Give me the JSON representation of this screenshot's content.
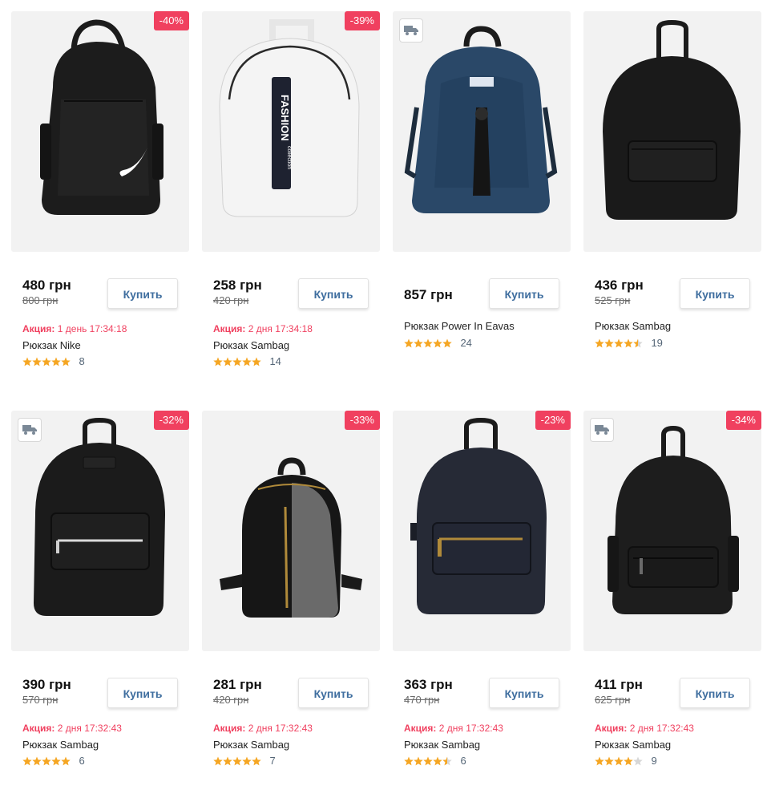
{
  "products": [
    {
      "discount": "-40%",
      "delivery": false,
      "price": "480 грн",
      "old_price": "800 грн",
      "promo_label": "Акция:",
      "promo_time": "1 день 17:34:18",
      "name": "Рюкзак Nike",
      "rating": 5,
      "reviews": "8",
      "buy_label": "Купить",
      "image": "black-nike-backpack"
    },
    {
      "discount": "-39%",
      "delivery": false,
      "price": "258 грн",
      "old_price": "420 грн",
      "promo_label": "Акция:",
      "promo_time": "2 дня 17:34:18",
      "name": "Рюкзак Sambag",
      "rating": 5,
      "reviews": "14",
      "buy_label": "Купить",
      "image": "white-fashion-backpack",
      "image_text": "FASHION collection"
    },
    {
      "discount": "",
      "delivery": true,
      "price": "857 грн",
      "old_price": "",
      "promo_label": "",
      "promo_time": "",
      "name": "Рюкзак Power In Eavas",
      "rating": 5,
      "reviews": "24",
      "buy_label": "Купить",
      "image": "navy-blue-backpack"
    },
    {
      "discount": "",
      "delivery": false,
      "price": "436 грн",
      "old_price": "525 грн",
      "promo_label": "",
      "promo_time": "",
      "name": "Рюкзак Sambag",
      "rating": 4.5,
      "reviews": "19",
      "buy_label": "Купить",
      "image": "black-leather-backpack"
    },
    {
      "discount": "-32%",
      "delivery": true,
      "price": "390 грн",
      "old_price": "570 грн",
      "promo_label": "Акция:",
      "promo_time": "2 дня 17:32:43",
      "name": "Рюкзак Sambag",
      "rating": 5,
      "reviews": "6",
      "buy_label": "Купить",
      "image": "black-leather-backpack-zip"
    },
    {
      "discount": "-33%",
      "delivery": false,
      "price": "281 грн",
      "old_price": "420 грн",
      "promo_label": "Акция:",
      "promo_time": "2 дня 17:32:43",
      "name": "Рюкзак Sambag",
      "rating": 5,
      "reviews": "7",
      "buy_label": "Купить",
      "image": "black-silver-mini-backpack"
    },
    {
      "discount": "-23%",
      "delivery": false,
      "price": "363 грн",
      "old_price": "470 грн",
      "promo_label": "Акция:",
      "promo_time": "2 дня 17:32:43",
      "name": "Рюкзак Sambag",
      "rating": 4.5,
      "reviews": "6",
      "buy_label": "Купить",
      "image": "dark-navy-leather-backpack"
    },
    {
      "discount": "-34%",
      "delivery": true,
      "price": "411 грн",
      "old_price": "625 грн",
      "promo_label": "Акция:",
      "promo_time": "2 дня 17:32:43",
      "name": "Рюкзак Sambag",
      "rating": 4,
      "reviews": "9",
      "buy_label": "Купить",
      "image": "black-matte-backpack"
    }
  ],
  "colors": {
    "badge": "#f0405f",
    "promo": "#f0405f",
    "buy_text": "#3f6e9f",
    "star": "#f5a623",
    "star_empty": "#d6d6d6"
  }
}
